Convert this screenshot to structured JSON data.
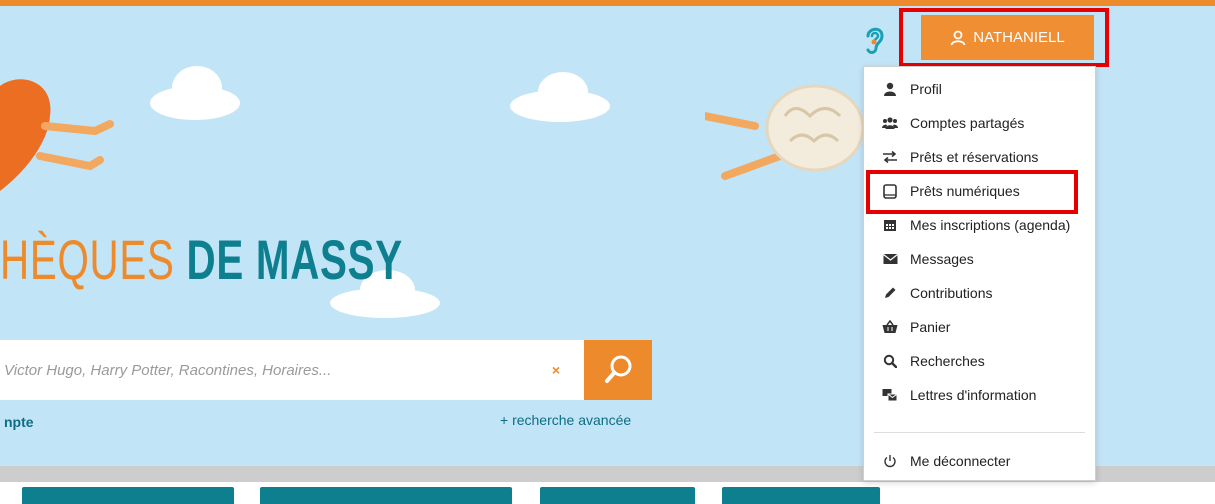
{
  "header": {
    "brand_part1": "HÈQUES",
    "brand_part2": "DE MASSY",
    "user_button_label": "NATHANIELL",
    "ear_icon": "hearing-icon"
  },
  "search": {
    "placeholder": "Victor Hugo, Harry Potter, Racontines, Horaires...",
    "clear_symbol": "×",
    "account_link": "npte",
    "advanced_link": "+  recherche avancée"
  },
  "user_menu": {
    "items": [
      {
        "label": "Profil",
        "icon": "user-icon"
      },
      {
        "label": "Comptes partagés",
        "icon": "users-icon"
      },
      {
        "label": "Prêts et réservations",
        "icon": "exchange-icon"
      },
      {
        "label": "Prêts numériques",
        "icon": "tablet-icon"
      },
      {
        "label": "Mes inscriptions (agenda)",
        "icon": "calendar-icon"
      },
      {
        "label": "Messages",
        "icon": "envelope-icon"
      },
      {
        "label": "Contributions",
        "icon": "pencil-icon"
      },
      {
        "label": "Panier",
        "icon": "basket-icon"
      },
      {
        "label": "Recherches",
        "icon": "search-icon"
      },
      {
        "label": "Lettres d'information",
        "icon": "newsletter-icon"
      }
    ],
    "logout_label": "Me déconnecter",
    "logout_icon": "power-icon"
  },
  "colors": {
    "accent": "#ed8a2b",
    "teal": "#0d7f8f",
    "sky": "#c2e4f7",
    "highlight": "#e60000"
  }
}
